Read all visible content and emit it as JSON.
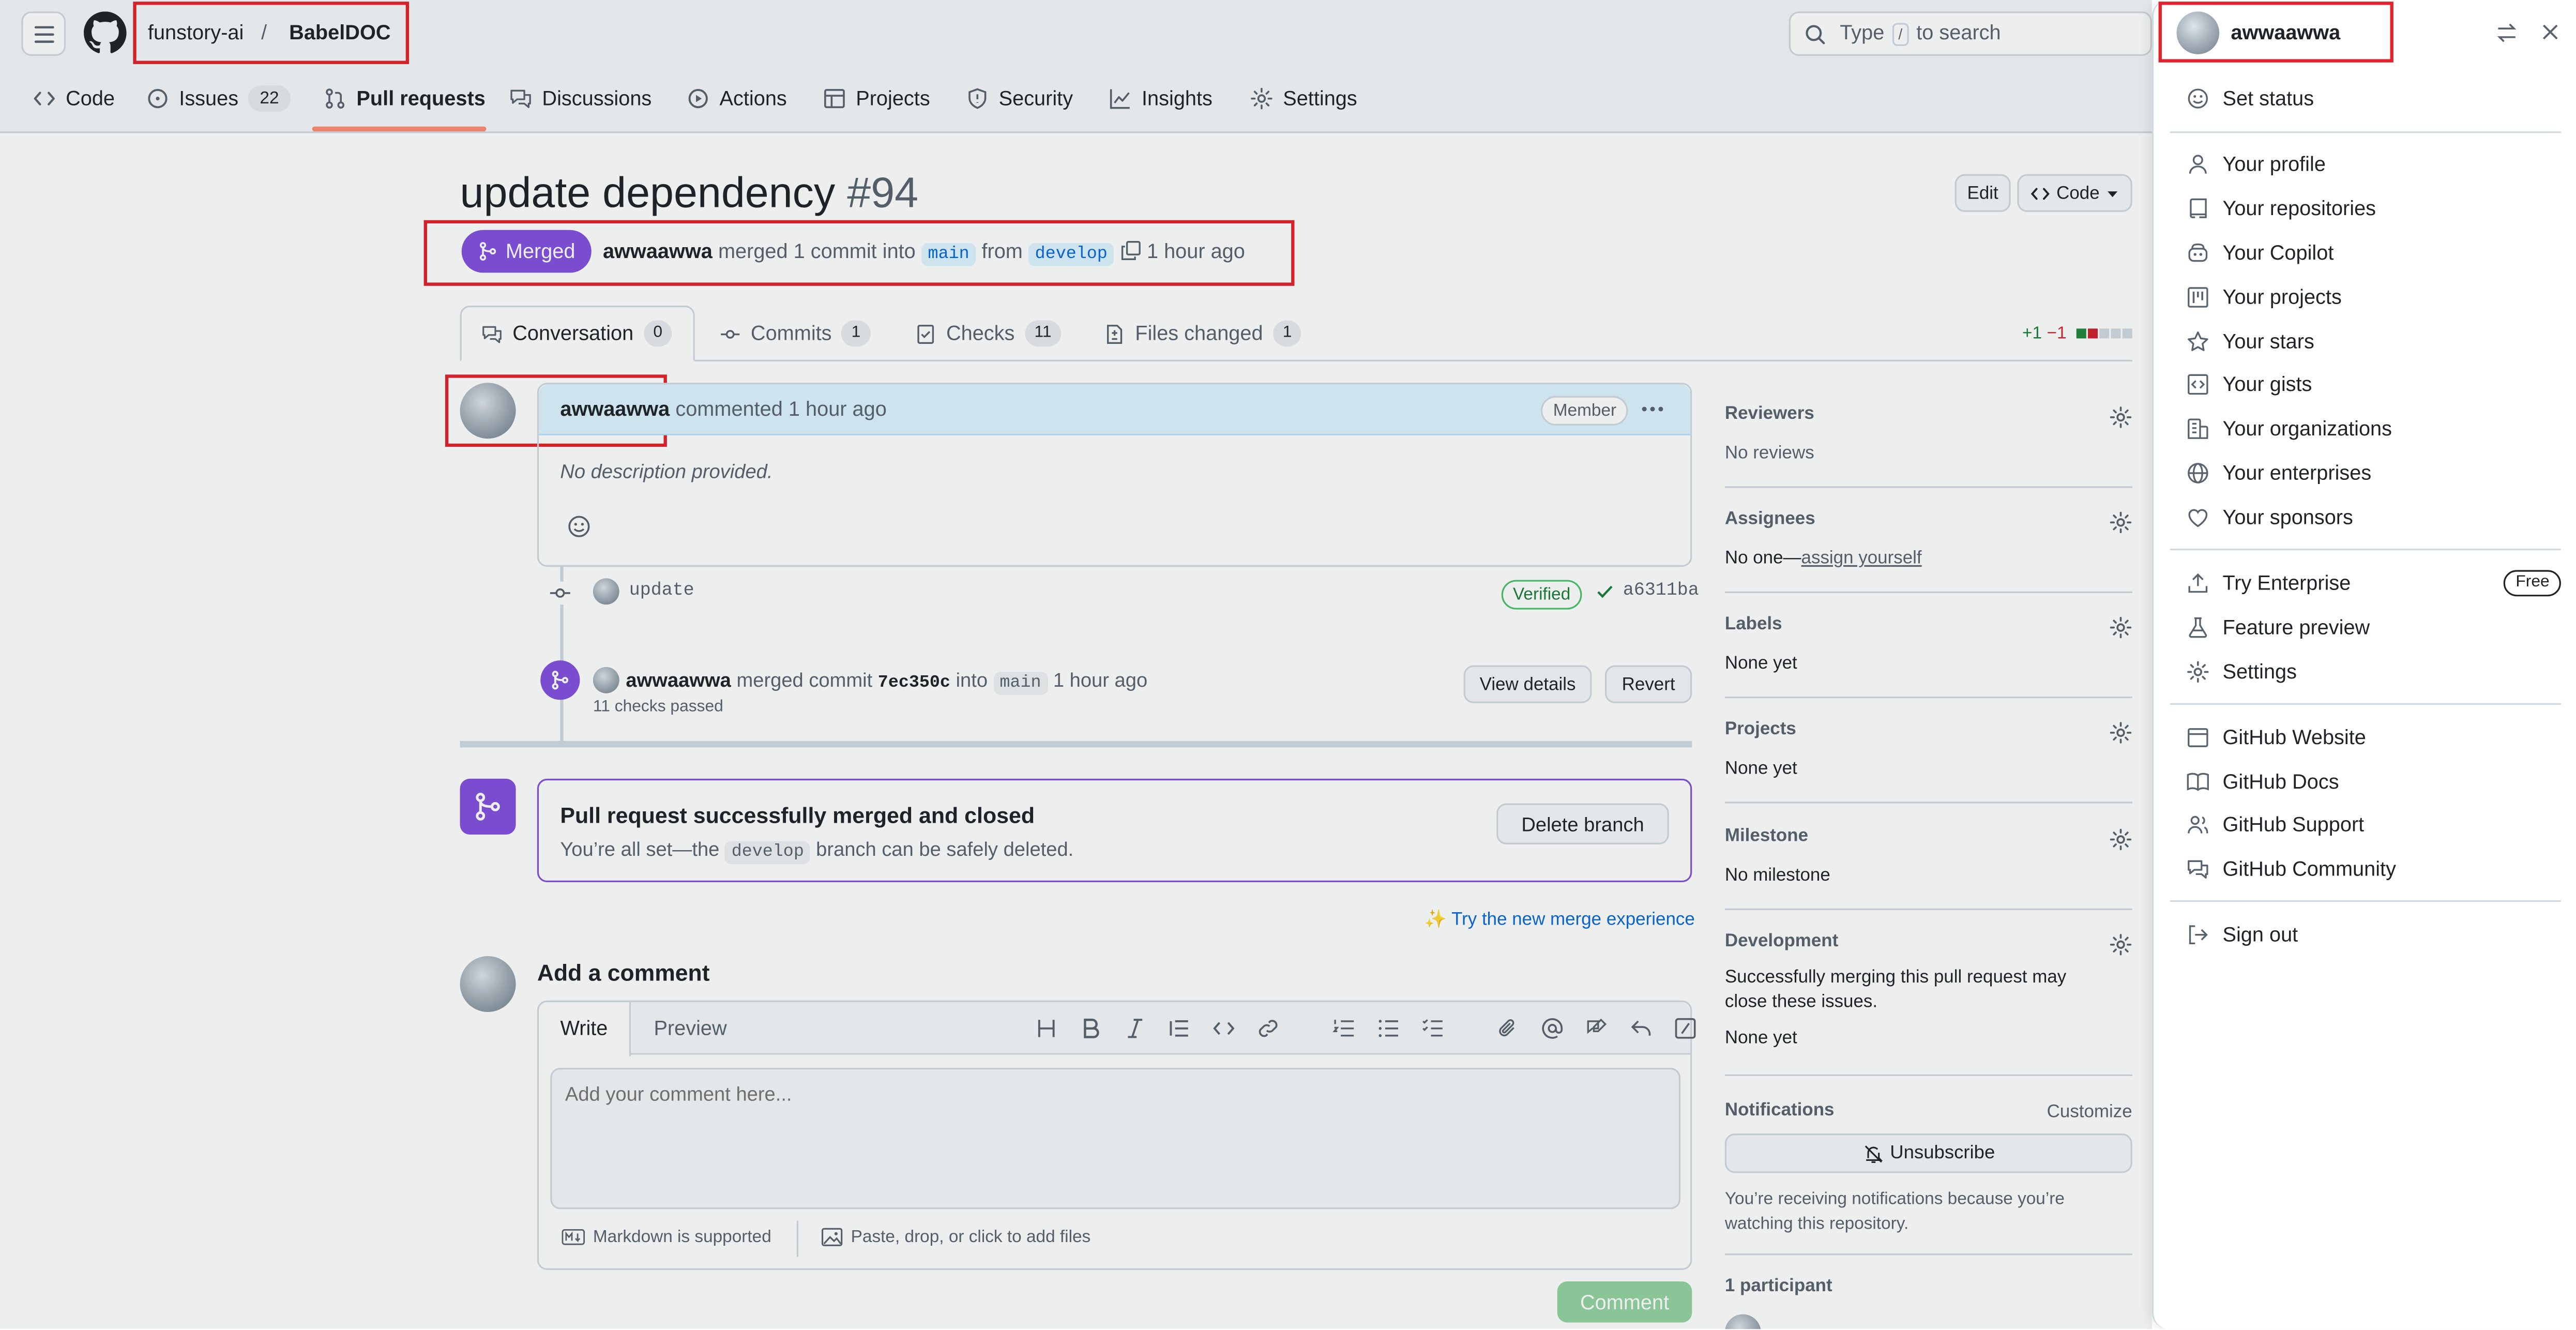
{
  "header": {
    "org": "funstory-ai",
    "separator": "/",
    "repo": "BabelDOC",
    "search_prefix": "Type",
    "search_key": "/",
    "search_suffix": "to search"
  },
  "repo_nav": [
    {
      "label": "Code",
      "icon": "code-icon"
    },
    {
      "label": "Issues",
      "icon": "issue-icon",
      "count": "22"
    },
    {
      "label": "Pull requests",
      "icon": "pull-request-icon"
    },
    {
      "label": "Discussions",
      "icon": "discussion-icon"
    },
    {
      "label": "Actions",
      "icon": "play-icon"
    },
    {
      "label": "Projects",
      "icon": "table-icon"
    },
    {
      "label": "Security",
      "icon": "shield-icon"
    },
    {
      "label": "Insights",
      "icon": "graph-icon"
    },
    {
      "label": "Settings",
      "icon": "gear-icon"
    }
  ],
  "pr": {
    "title": "update dependency",
    "number": "#94",
    "edit_label": "Edit",
    "code_label": "Code",
    "state": "Merged",
    "author": "awwaawwa",
    "meta_text": "merged 1 commit into",
    "base_branch": "main",
    "from_text": "from",
    "head_branch": "develop",
    "time": "1 hour ago"
  },
  "tabs": [
    {
      "label": "Conversation",
      "count": "0"
    },
    {
      "label": "Commits",
      "count": "1"
    },
    {
      "label": "Checks",
      "count": "11"
    },
    {
      "label": "Files changed",
      "count": "1"
    }
  ],
  "diffstat": {
    "added": "+1",
    "removed": "−1"
  },
  "comment": {
    "author": "awwaawwa",
    "action": "commented",
    "time": "1 hour ago",
    "role": "Member",
    "body": "No description provided."
  },
  "commit_event": {
    "message": "update",
    "verified": "Verified",
    "sha": "a6311ba"
  },
  "merge_event": {
    "author": "awwaawwa",
    "text": "merged commit",
    "sha": "7ec350c",
    "into": "into",
    "branch": "main",
    "time": "1 hour ago",
    "checks": "11 checks passed",
    "view_details": "View details",
    "revert": "Revert"
  },
  "merged_box": {
    "title": "Pull request successfully merged and closed",
    "text_before": "You’re all set—the",
    "branch": "develop",
    "text_after": "branch can be safely deleted.",
    "delete_button": "Delete branch"
  },
  "try_merge": "Try the new merge experience",
  "add_comment": {
    "heading": "Add a comment",
    "write_tab": "Write",
    "preview_tab": "Preview",
    "placeholder": "Add your comment here...",
    "markdown_note": "Markdown is supported",
    "attach_note": "Paste, drop, or click to add files",
    "submit": "Comment"
  },
  "sidebar": {
    "reviewers": {
      "heading": "Reviewers",
      "value": "No reviews"
    },
    "assignees": {
      "heading": "Assignees",
      "value": "No one—",
      "link": "assign yourself"
    },
    "labels": {
      "heading": "Labels",
      "value": "None yet"
    },
    "projects": {
      "heading": "Projects",
      "value": "None yet"
    },
    "milestone": {
      "heading": "Milestone",
      "value": "No milestone"
    },
    "development": {
      "heading": "Development",
      "desc": "Successfully merging this pull request may close these issues.",
      "value": "None yet"
    },
    "notifications": {
      "heading": "Notifications",
      "customize": "Customize",
      "button": "Unsubscribe",
      "desc": "You’re receiving notifications because you’re watching this repository."
    },
    "participants": {
      "heading": "1 participant"
    }
  },
  "user_menu": {
    "username": "awwaawwa",
    "items": [
      {
        "label": "Set status",
        "icon": "smiley-icon"
      },
      {
        "label": "Your profile",
        "icon": "person-icon"
      },
      {
        "label": "Your repositories",
        "icon": "repo-icon"
      },
      {
        "label": "Your Copilot",
        "icon": "copilot-icon"
      },
      {
        "label": "Your projects",
        "icon": "project-icon"
      },
      {
        "label": "Your stars",
        "icon": "star-icon"
      },
      {
        "label": "Your gists",
        "icon": "gist-icon"
      },
      {
        "label": "Your organizations",
        "icon": "organization-icon"
      },
      {
        "label": "Your enterprises",
        "icon": "globe-icon"
      },
      {
        "label": "Your sponsors",
        "icon": "heart-icon"
      },
      {
        "label": "Try Enterprise",
        "icon": "upload-icon",
        "badge": "Free"
      },
      {
        "label": "Feature preview",
        "icon": "beaker-icon"
      },
      {
        "label": "Settings",
        "icon": "gear-icon"
      },
      {
        "label": "GitHub Website",
        "icon": "browser-icon"
      },
      {
        "label": "GitHub Docs",
        "icon": "book-icon"
      },
      {
        "label": "GitHub Support",
        "icon": "people-icon"
      },
      {
        "label": "GitHub Community",
        "icon": "comment-discussion-icon"
      },
      {
        "label": "Sign out",
        "icon": "sign-out-icon"
      }
    ]
  },
  "colors": {
    "merged": "#8250df",
    "link": "#0969da",
    "highlight_box": "#e5212b",
    "selected_tab_underline": "#fd8c73",
    "comment_button": "#1f883d"
  }
}
